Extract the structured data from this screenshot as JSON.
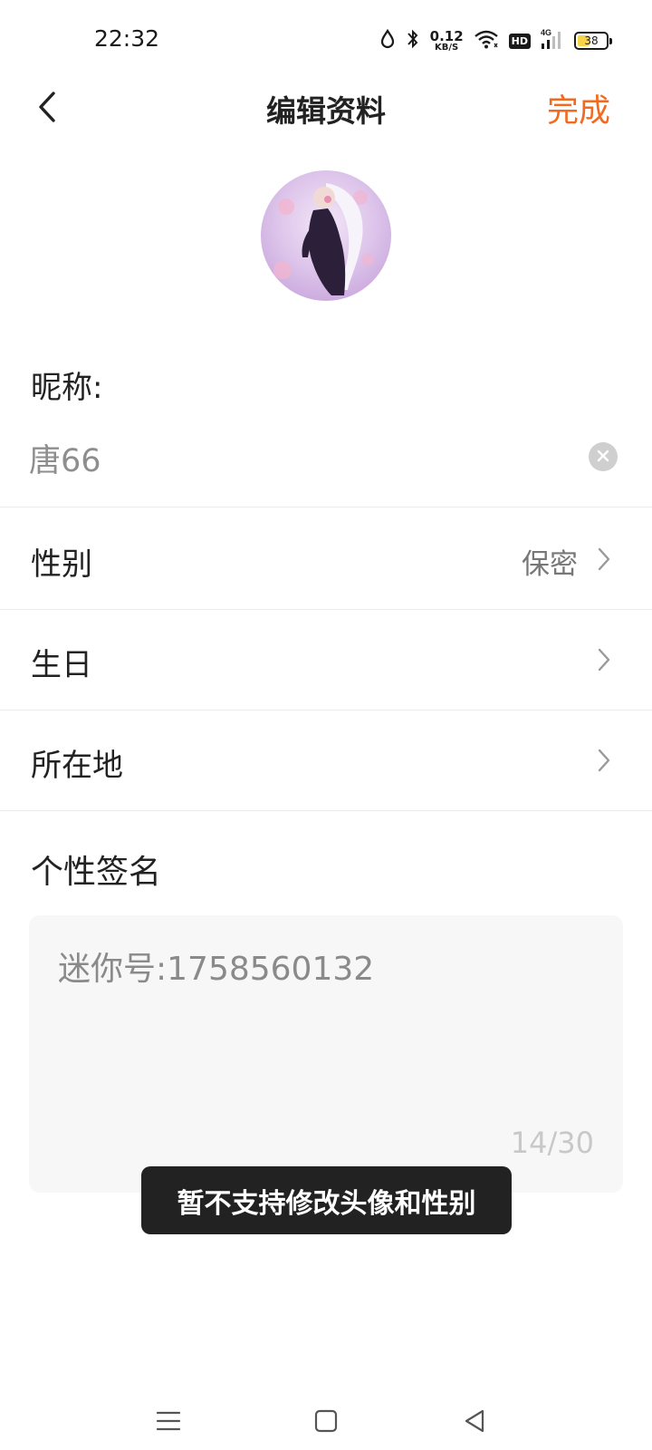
{
  "status_bar": {
    "time": "22:32",
    "net_speed_value": "0.12",
    "net_speed_unit": "KB/S",
    "hd_label": "HD",
    "network_label": "4G",
    "battery_level": "38",
    "icons": [
      "drop-icon",
      "bluetooth-icon",
      "wifi-icon",
      "hd-icon",
      "signal-icon",
      "battery-icon"
    ]
  },
  "header": {
    "back_icon": "chevron-left-icon",
    "title": "编辑资料",
    "done_label": "完成",
    "accent_color": "#f26a22"
  },
  "profile": {
    "avatar_icon": "avatar-image",
    "nickname_label": "昵称:",
    "nickname_value": "唐66",
    "clear_icon": "clear-icon"
  },
  "rows": [
    {
      "label": "性别",
      "value": "保密",
      "icon": "chevron-right-icon"
    },
    {
      "label": "生日",
      "value": "",
      "icon": "chevron-right-icon"
    },
    {
      "label": "所在地",
      "value": "",
      "icon": "chevron-right-icon"
    }
  ],
  "signature": {
    "label": "个性签名",
    "value": "迷你号:1758560132",
    "counter": "14/30"
  },
  "toast": {
    "message": "暂不支持修改头像和性别"
  },
  "system_nav": {
    "icons": [
      "menu-icon",
      "home-icon",
      "back-triangle-icon"
    ]
  }
}
